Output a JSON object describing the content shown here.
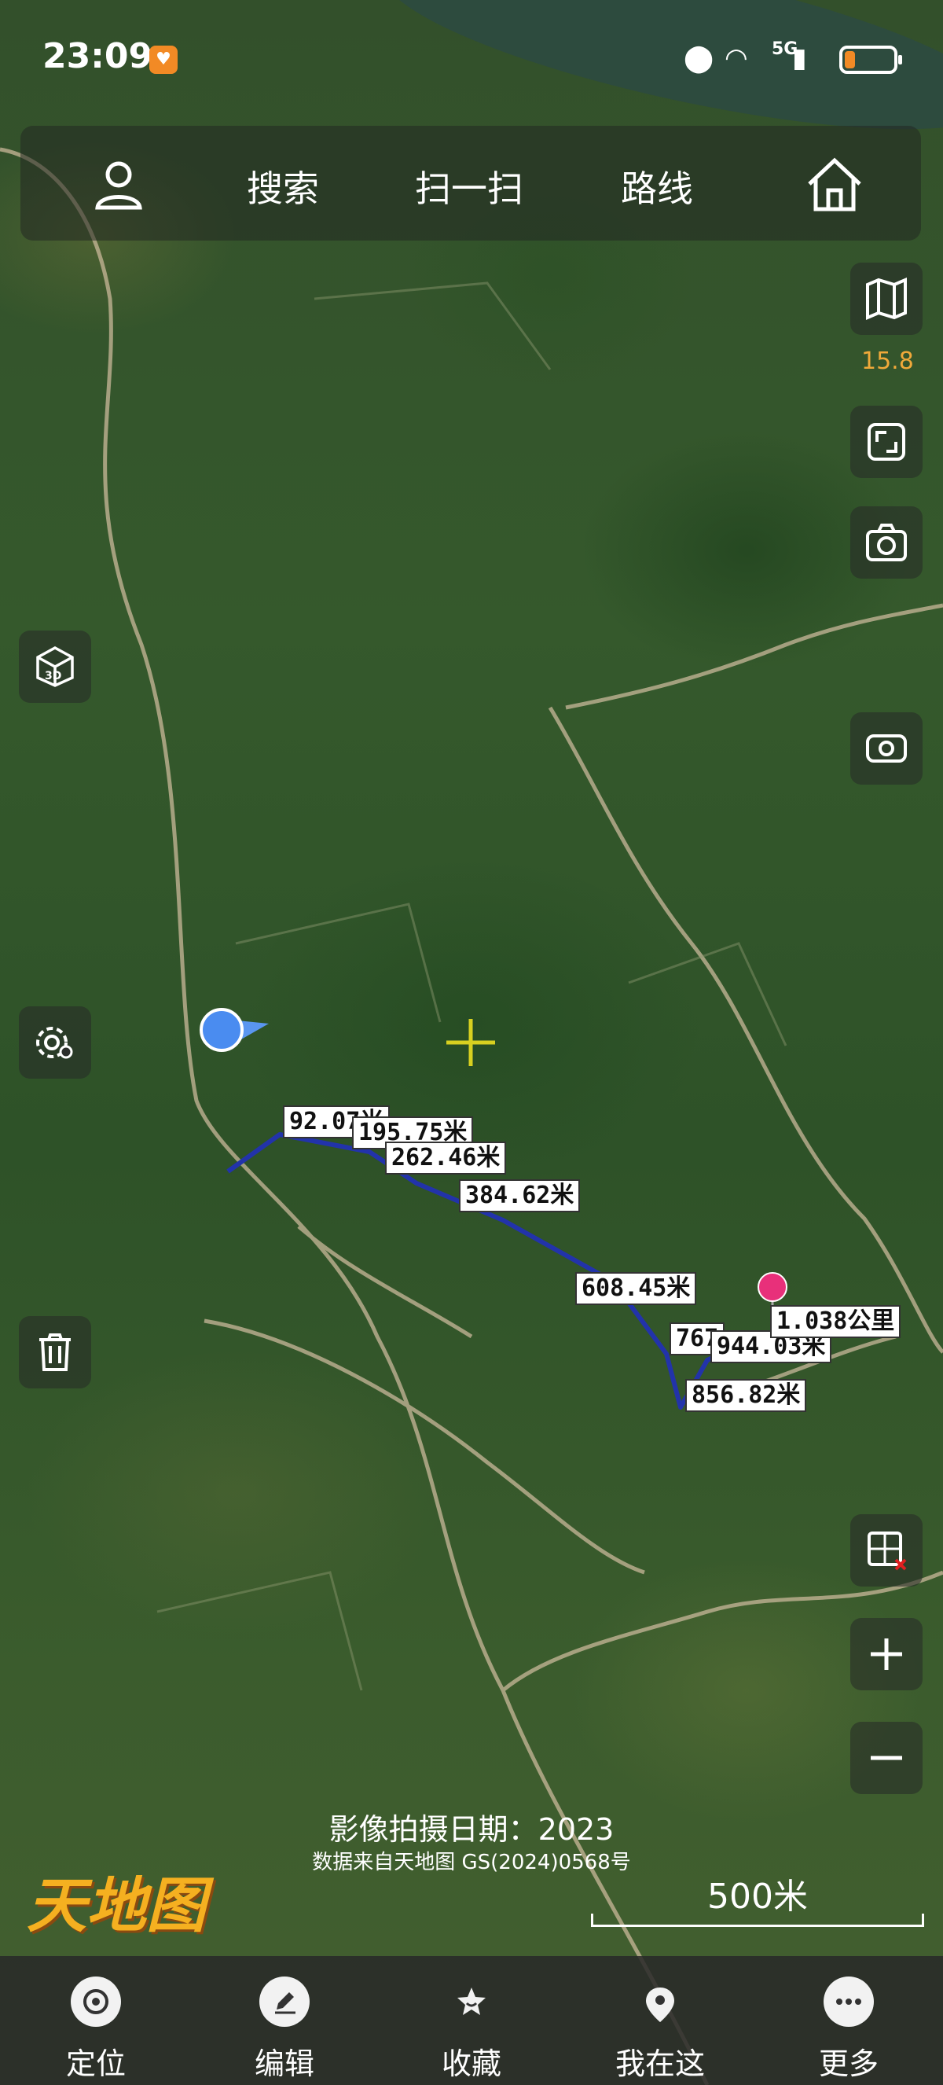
{
  "status_bar": {
    "time": "23:09",
    "network": "5G",
    "battery_level": 0.22
  },
  "top_bar": {
    "user_label": "用户",
    "search": "搜索",
    "scan": "扫一扫",
    "route": "路线",
    "home_label": "首页"
  },
  "map": {
    "zoom_level": "15.8",
    "measure_labels": [
      "92.07米",
      "195.75米",
      "262.46米",
      "384.62米",
      "608.45米",
      "767",
      "944.03米",
      "856.82米",
      "1.038公里"
    ],
    "imagery_date": "影像拍摄日期：2023",
    "data_source": "数据来自天地图 GS(2024)0568号",
    "scale": "500米",
    "logo_text": "天地图"
  },
  "right_controls": [
    "map-layers-icon",
    "fullscreen-icon",
    "camera-icon",
    "screen-capture-icon",
    "clear-layer-icon",
    "zoom-in-icon",
    "zoom-out-icon"
  ],
  "left_controls": [
    "3d-icon",
    "settings-icon",
    "trash-icon"
  ],
  "bottom_nav": [
    {
      "label": "定位",
      "icon": "locate-icon"
    },
    {
      "label": "编辑",
      "icon": "edit-icon"
    },
    {
      "label": "收藏",
      "icon": "favorite-icon"
    },
    {
      "label": "我在这",
      "icon": "location-pin-icon"
    },
    {
      "label": "更多",
      "icon": "more-icon"
    }
  ],
  "colors": {
    "route": "#2233aa",
    "accent": "#f0a93a",
    "pin": "#e8307a",
    "location": "#4a8cf0"
  }
}
